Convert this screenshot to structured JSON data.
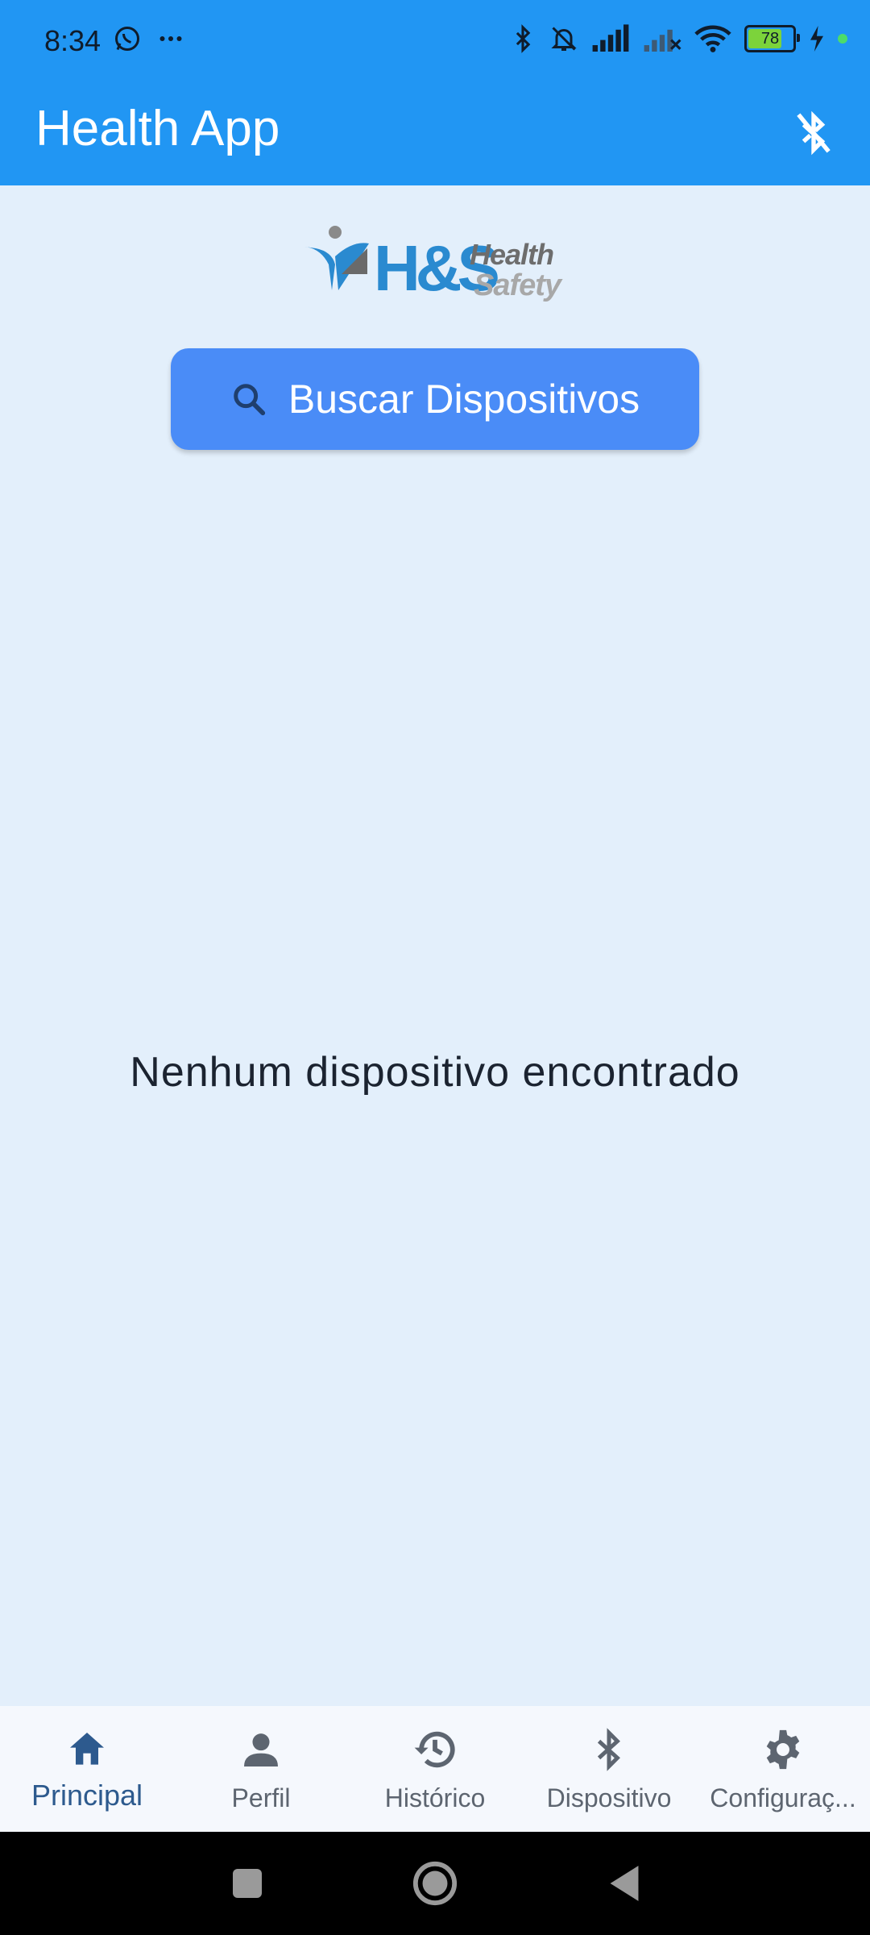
{
  "status_bar": {
    "time": "8:34",
    "battery_level": "78",
    "battery_fraction": 0.78,
    "icons": [
      "whatsapp-icon",
      "more-dots-icon",
      "bluetooth-icon",
      "bell-off-icon",
      "signal-icon",
      "signal-no-service-icon",
      "wifi-icon",
      "battery-icon",
      "charging-icon"
    ]
  },
  "app_bar": {
    "title": "Health App",
    "action_icon": "bluetooth-disabled-icon"
  },
  "logo": {
    "text_main": "H&S",
    "text_top": "Health",
    "text_bottom": "Safety"
  },
  "search_button": {
    "label": "Buscar Dispositivos",
    "icon": "search-icon"
  },
  "empty_message": "Nenhum dispositivo encontrado",
  "bottom_nav": {
    "items": [
      {
        "label": "Principal",
        "icon": "home-icon",
        "active": true
      },
      {
        "label": "Perfil",
        "icon": "person-icon",
        "active": false
      },
      {
        "label": "Histórico",
        "icon": "history-icon",
        "active": false
      },
      {
        "label": "Dispositivo",
        "icon": "bluetooth-icon",
        "active": false
      },
      {
        "label": "Configuraç...",
        "icon": "gear-icon",
        "active": false
      }
    ]
  },
  "colors": {
    "primary": "#2196f3",
    "button": "#4a8cf7",
    "background": "#e3effb",
    "nav_active": "#2d5a8e"
  }
}
